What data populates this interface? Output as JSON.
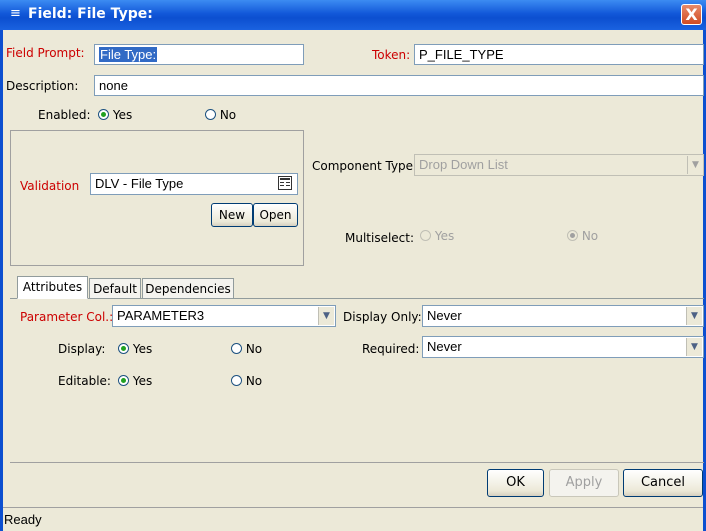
{
  "window": {
    "title": "Field: File Type:",
    "close_glyph": "X",
    "icon": "window-icon"
  },
  "header": {
    "field_prompt_label": "Field Prompt:",
    "field_prompt_value": "File Type:",
    "token_label": "Token:",
    "token_value": "P_FILE_TYPE",
    "description_label": "Description:",
    "description_value": "none",
    "enabled_label": "Enabled:",
    "enabled_yes": "Yes",
    "enabled_no": "No",
    "enabled_selected": "Yes"
  },
  "validation": {
    "label": "Validation",
    "value": "DLV - File Type",
    "new_button": "New",
    "open_button": "Open"
  },
  "component": {
    "type_label": "Component Type:",
    "type_value": "Drop Down List",
    "multiselect_label": "Multiselect:",
    "multiselect_yes": "Yes",
    "multiselect_no": "No",
    "multiselect_selected": "No"
  },
  "tabs": [
    {
      "label": "Attributes",
      "active": true
    },
    {
      "label": "Default",
      "active": false
    },
    {
      "label": "Dependencies",
      "active": false
    }
  ],
  "attributes": {
    "parameter_col_label": "Parameter Col.:",
    "parameter_col_value": "PARAMETER3",
    "display_only_label": "Display Only:",
    "display_only_value": "Never",
    "display_label": "Display:",
    "display_yes": "Yes",
    "display_no": "No",
    "required_label": "Required:",
    "required_value": "Never",
    "editable_label": "Editable:",
    "editable_yes": "Yes",
    "editable_no": "No"
  },
  "footer": {
    "ok": "OK",
    "apply": "Apply",
    "cancel": "Cancel"
  },
  "status": {
    "text": "Ready"
  },
  "colors": {
    "title_bar": "#0c4fd0",
    "required_label": "#cc0000",
    "face": "#ece9d8",
    "selection": "#316ac5"
  }
}
